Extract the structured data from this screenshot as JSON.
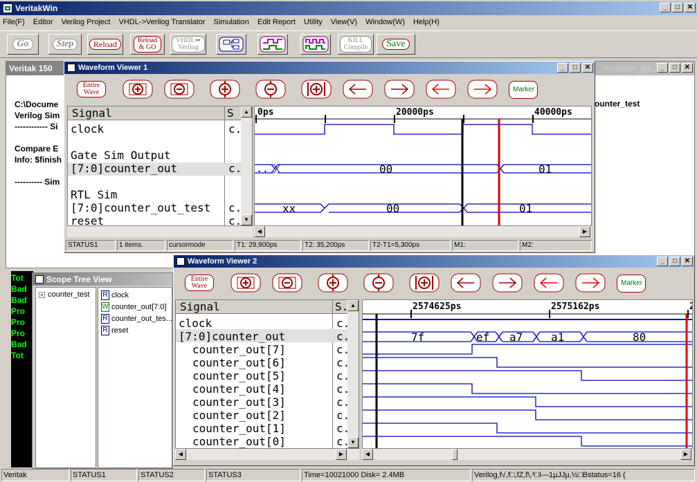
{
  "app": {
    "title": "VeritakWin",
    "min": "_",
    "max": "□",
    "close": "✕"
  },
  "menu": [
    "File(F)",
    "Editor",
    "Verilog Project",
    "VHDL->Verilog Translator",
    "Simulation",
    "Edit Report",
    "Utility",
    "View(V)",
    "Window(W)",
    "Help(H)"
  ],
  "toolbar": {
    "go": "Go",
    "step": "Step",
    "reload": "Reload",
    "reload_go_1": "Reload",
    "reload_go_2": "& GO",
    "vhdl_1": "VHDL➡",
    "vhdl_2": "Verilog",
    "kill_1": "KILL",
    "kill_2": "Compile",
    "save": "Save"
  },
  "console": {
    "title": "Veritak 150",
    "right_title": "n\\counter_ga...",
    "lines": [
      "C:\\Docume",
      "Verilog Sim",
      "------------ Si",
      "",
      "Compare E",
      "Info: $finish",
      "",
      "---------- Sim"
    ],
    "right_text": "ounter_test"
  },
  "wv1": {
    "title": "Waveform Viewer 1",
    "entire_1": "Entire",
    "entire_2": "Wave",
    "marker": "Marker",
    "sig_header": "Signal",
    "s_header": "S",
    "signals": [
      {
        "name": "clock",
        "s": "c."
      },
      {
        "name": "Gate Sim Output",
        "s": ""
      },
      {
        "name": "[7:0]counter_out",
        "s": "c."
      },
      {
        "name": "RTL Sim",
        "s": ""
      },
      {
        "name": "[7:0]counter_out_test",
        "s": "c."
      },
      {
        "name": "reset",
        "s": "c."
      }
    ],
    "time_labels": [
      "0ps",
      "20000ps",
      "40000ps"
    ],
    "bus1": [
      "..",
      "00",
      "01"
    ],
    "bus2": [
      "xx",
      "00",
      "01"
    ],
    "status": [
      "STATUS1",
      "1 items.",
      "cursormode",
      "T1: 29,900ps",
      "T2: 35,200ps",
      "T2-T1=5,300ps",
      "M1:",
      "M2:"
    ]
  },
  "wv2": {
    "title": "Waveform Viewer 2",
    "entire_1": "Entire",
    "entire_2": "Wave",
    "marker": "Marker",
    "sig_header": "Signal",
    "s_header": "S.",
    "signals": [
      {
        "name": "clock",
        "s": "c."
      },
      {
        "name": "[7:0]counter_out",
        "s": "c."
      },
      {
        "name": "counter_out[7]",
        "s": "c."
      },
      {
        "name": "counter_out[6]",
        "s": "c."
      },
      {
        "name": "counter_out[5]",
        "s": "c."
      },
      {
        "name": "counter_out[4]",
        "s": "c."
      },
      {
        "name": "counter_out[3]",
        "s": "c."
      },
      {
        "name": "counter_out[2]",
        "s": "c."
      },
      {
        "name": "counter_out[1]",
        "s": "c."
      },
      {
        "name": "counter_out[0]",
        "s": "c."
      }
    ],
    "time_labels": [
      "2574625ps",
      "2575162ps",
      "2"
    ],
    "bus": [
      "7f",
      "ef",
      "a7",
      "a1",
      "80"
    ]
  },
  "scope": {
    "title": "Scope Tree View",
    "root": "counter_test",
    "items": [
      {
        "badge": "R",
        "name": "clock"
      },
      {
        "badge": "W",
        "name": "counter_out[7:0]"
      },
      {
        "badge": "R",
        "name": "counter_out_tes..."
      },
      {
        "badge": "R",
        "name": "reset"
      }
    ]
  },
  "console_left": [
    "Tot",
    "Bad",
    "Bad",
    "Pro",
    "Pro",
    "Pro",
    "Bad",
    "Tot"
  ],
  "statusbar": [
    "Veritak",
    "STATUS1",
    "STATUS2",
    "STATUS3",
    "Time=10021000 Disk= 2.4MB",
    "Verilog,f√,f□,fZ,f\\,³□I—1µJJµ,½□Bstatus=16 ("
  ]
}
